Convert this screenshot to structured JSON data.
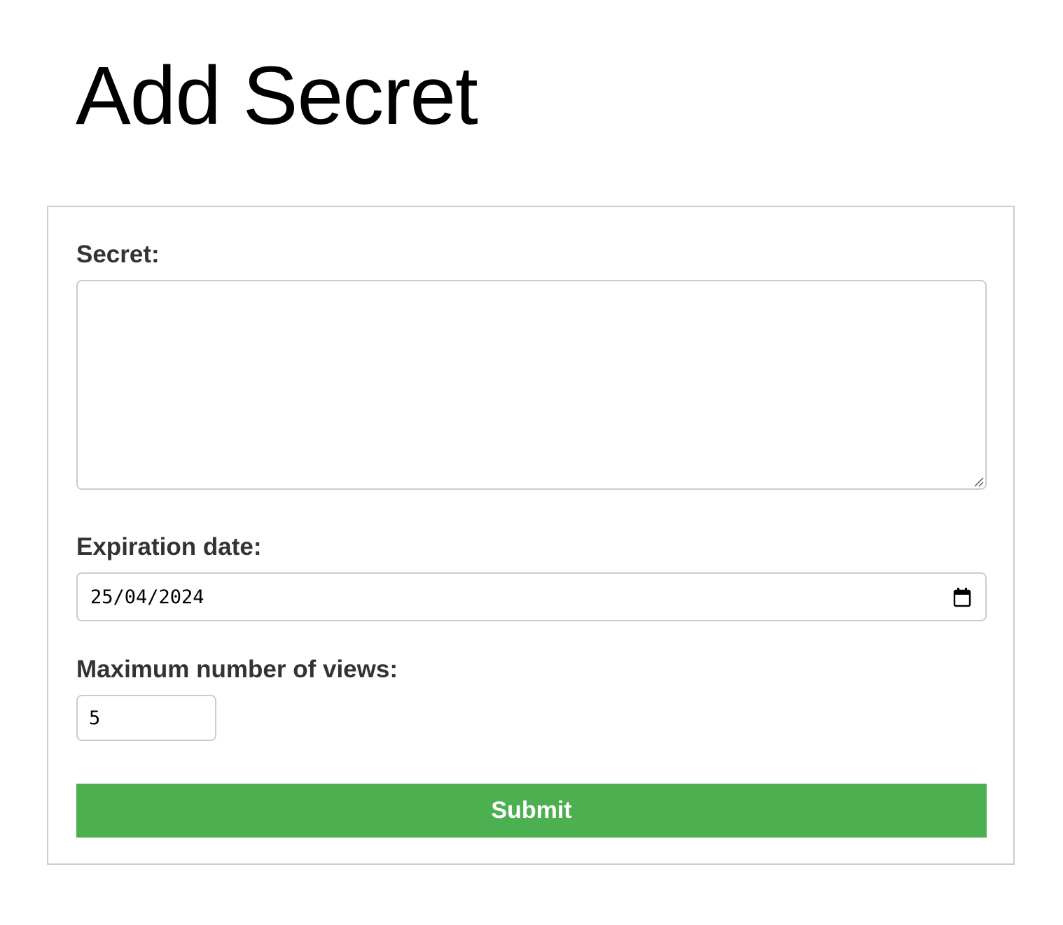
{
  "page": {
    "title": "Add Secret"
  },
  "form": {
    "secret": {
      "label": "Secret:",
      "value": ""
    },
    "expiration": {
      "label": "Expiration date:",
      "value": "25/04/2024",
      "icon": "calendar-icon"
    },
    "views": {
      "label": "Maximum number of views:",
      "value": "5"
    },
    "submit_label": "Submit"
  },
  "colors": {
    "accent": "#4caf50",
    "border": "#cccccc",
    "label_text": "#333333"
  }
}
